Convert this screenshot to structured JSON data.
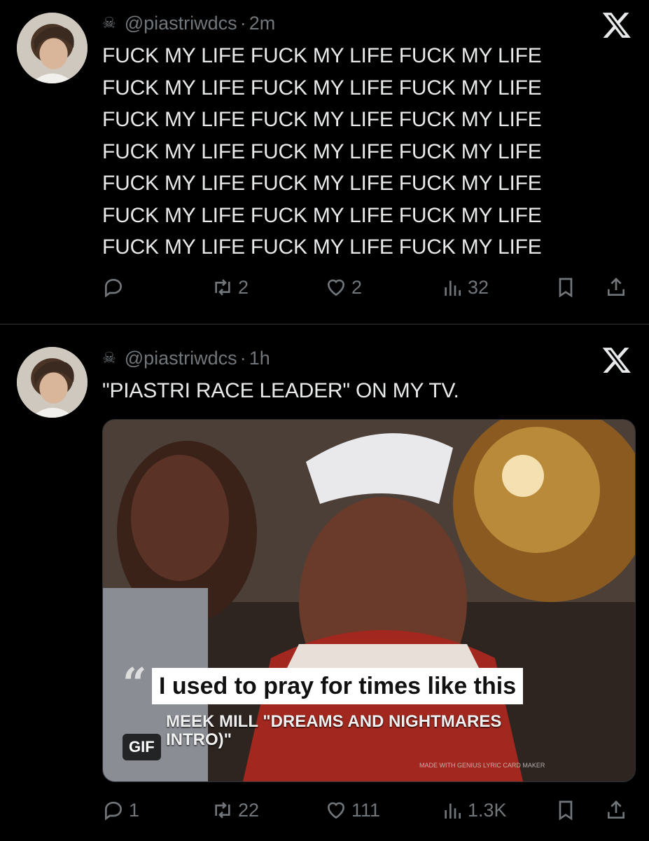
{
  "tweets": [
    {
      "handle": "@piastriwdcs",
      "time": "2m",
      "lines": [
        "FUCK MY LIFE FUCK MY LIFE FUCK MY LIFE",
        "FUCK MY LIFE FUCK MY LIFE FUCK MY LIFE",
        "FUCK MY LIFE FUCK MY LIFE FUCK MY LIFE",
        "FUCK MY LIFE FUCK MY LIFE FUCK MY LIFE",
        "FUCK MY LIFE FUCK MY LIFE FUCK MY LIFE",
        "FUCK MY LIFE FUCK MY LIFE FUCK MY LIFE",
        "FUCK MY LIFE FUCK MY LIFE FUCK MY LIFE"
      ],
      "actions": {
        "replies": "",
        "retweets": "2",
        "likes": "2",
        "views": "32"
      }
    },
    {
      "handle": "@piastriwdcs",
      "time": "1h",
      "lines": [
        "\"PIASTRI RACE LEADER\" ON MY TV."
      ],
      "media": {
        "caption": "I used to pray for times like this",
        "subcaption_line1": "MEEK MILL \"DREAMS AND NIGHTMARES",
        "subcaption_line2": "INTRO)\"",
        "watermark": "MADE WITH GENIUS LYRIC CARD MAKER",
        "badge": "GIF"
      },
      "actions": {
        "replies": "1",
        "retweets": "22",
        "likes": "111",
        "views": "1.3K"
      }
    }
  ],
  "icons": {
    "skull": "skull-crossbones-icon",
    "dot": "·",
    "quote": "“"
  },
  "colors": {
    "background": "#000000",
    "text": "#e7e9ea",
    "muted": "#71767b",
    "divider": "#2f3336"
  }
}
